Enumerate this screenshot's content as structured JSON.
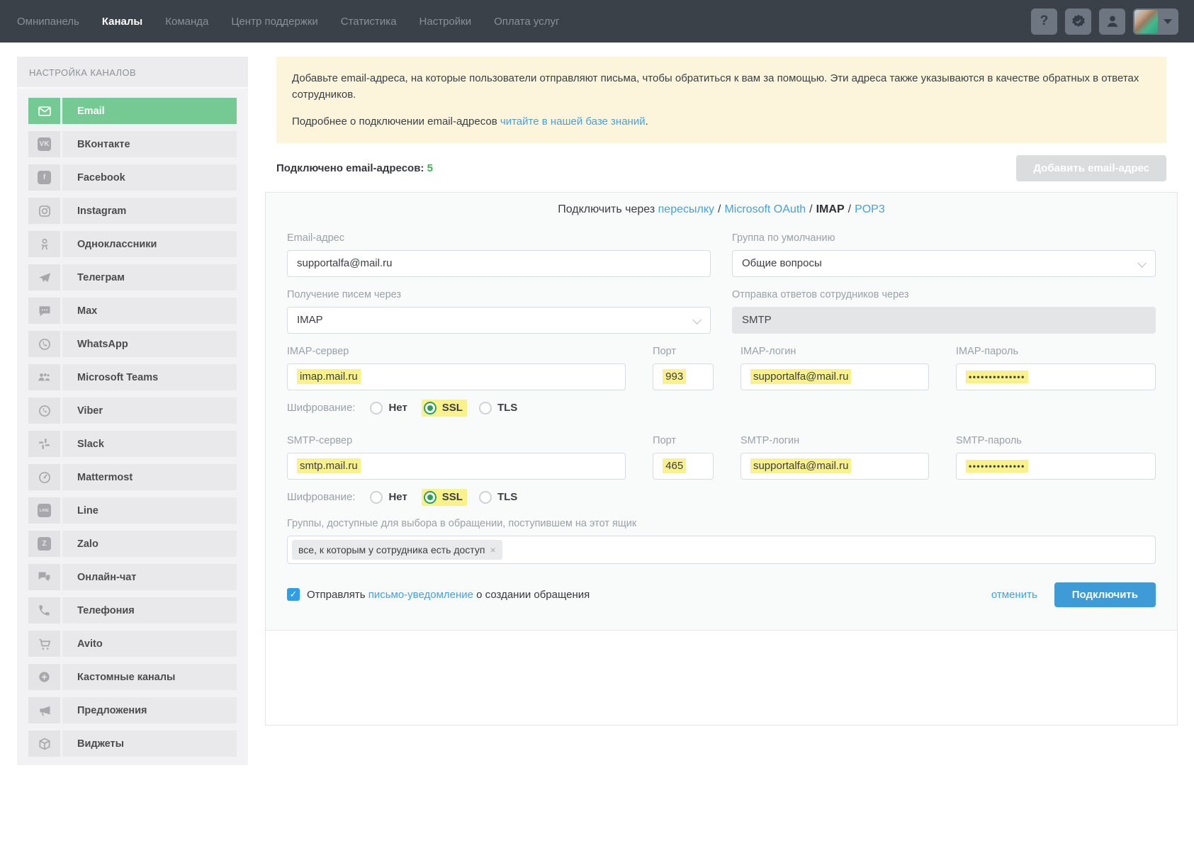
{
  "nav": {
    "items": [
      {
        "id": "omnipanel",
        "label": "Омнипанель",
        "active": false
      },
      {
        "id": "channels",
        "label": "Каналы",
        "active": true
      },
      {
        "id": "team",
        "label": "Команда",
        "active": false
      },
      {
        "id": "support-center",
        "label": "Центр поддержки",
        "active": false
      },
      {
        "id": "statistics",
        "label": "Статистика",
        "active": false
      },
      {
        "id": "settings",
        "label": "Настройки",
        "active": false
      },
      {
        "id": "payment",
        "label": "Оплата услуг",
        "active": false
      }
    ],
    "help_glyph": "?"
  },
  "sidebar": {
    "header": "НАСТРОЙКА КАНАЛОВ",
    "items": [
      {
        "id": "email",
        "label": "Email",
        "icon": "email-icon",
        "active": true
      },
      {
        "id": "vkontakte",
        "label": "ВКонтакте",
        "icon": "vk-icon",
        "active": false
      },
      {
        "id": "facebook",
        "label": "Facebook",
        "icon": "facebook-icon",
        "active": false
      },
      {
        "id": "instagram",
        "label": "Instagram",
        "icon": "instagram-icon",
        "active": false
      },
      {
        "id": "odnoklassniki",
        "label": "Одноклассники",
        "icon": "odnoklassniki-icon",
        "active": false
      },
      {
        "id": "telegram",
        "label": "Телеграм",
        "icon": "telegram-icon",
        "active": false
      },
      {
        "id": "max",
        "label": "Max",
        "icon": "max-icon",
        "active": false
      },
      {
        "id": "whatsapp",
        "label": "WhatsApp",
        "icon": "whatsapp-icon",
        "active": false
      },
      {
        "id": "microsoft-teams",
        "label": "Microsoft Teams",
        "icon": "teams-icon",
        "active": false
      },
      {
        "id": "viber",
        "label": "Viber",
        "icon": "viber-icon",
        "active": false
      },
      {
        "id": "slack",
        "label": "Slack",
        "icon": "slack-icon",
        "active": false
      },
      {
        "id": "mattermost",
        "label": "Mattermost",
        "icon": "mattermost-icon",
        "active": false
      },
      {
        "id": "line",
        "label": "Line",
        "icon": "line-icon",
        "active": false
      },
      {
        "id": "zalo",
        "label": "Zalo",
        "icon": "zalo-icon",
        "active": false
      },
      {
        "id": "online-chat",
        "label": "Онлайн-чат",
        "icon": "chat-icon",
        "active": false
      },
      {
        "id": "telephony",
        "label": "Телефония",
        "icon": "phone-icon",
        "active": false
      },
      {
        "id": "avito",
        "label": "Avito",
        "icon": "cart-icon",
        "active": false
      },
      {
        "id": "custom-channels",
        "label": "Кастомные каналы",
        "icon": "plus-icon",
        "active": false
      },
      {
        "id": "suggestions",
        "label": "Предложения",
        "icon": "megaphone-icon",
        "active": false
      },
      {
        "id": "widgets",
        "label": "Виджеты",
        "icon": "widgets-icon",
        "active": false
      }
    ]
  },
  "main": {
    "info": {
      "p1": "Добавьте email-адреса, на которые пользователи отправляют письма, чтобы обратиться к вам за помощью. Эти адреса также указываются в качестве обратных в ответах сотрудников.",
      "p2_prefix": "Подробнее о подключении email-адресов ",
      "p2_link": "читайте в нашей базе знаний",
      "p2_suffix": "."
    },
    "connected_label": "Подключено email-адресов:",
    "connected_count": "5",
    "add_button": "Добавить email-адрес",
    "methods": {
      "prefix": "Подключить через ",
      "items": [
        {
          "label": "пересылку",
          "active": false
        },
        {
          "label": "Microsoft OAuth",
          "active": false
        },
        {
          "label": "IMAP",
          "active": true
        },
        {
          "label": "POP3",
          "active": false
        }
      ],
      "separator": "/"
    },
    "form": {
      "email": {
        "label": "Email-адрес",
        "value": "supportalfa@mail.ru"
      },
      "group": {
        "label": "Группа по умолчанию",
        "value": "Общие вопросы"
      },
      "receive": {
        "label": "Получение писем через",
        "value": "IMAP"
      },
      "send": {
        "label": "Отправка ответов сотрудников через",
        "value": "SMTP"
      },
      "imap": {
        "server_label": "IMAP-сервер",
        "server": "imap.mail.ru",
        "port_label": "Порт",
        "port": "993",
        "login_label": "IMAP-логин",
        "login": "supportalfa@mail.ru",
        "password_label": "IMAP-пароль",
        "password": "••••••••••••••"
      },
      "smtp": {
        "server_label": "SMTP-сервер",
        "server": "smtp.mail.ru",
        "port_label": "Порт",
        "port": "465",
        "login_label": "SMTP-логин",
        "login": "supportalfa@mail.ru",
        "password_label": "SMTP-пароль",
        "password": "••••••••••••••"
      },
      "encryption": {
        "label": "Шифрование:",
        "options": [
          "Нет",
          "SSL",
          "TLS"
        ],
        "selected": "SSL"
      },
      "groups": {
        "label": "Группы, доступные для выбора в обращении, поступившем на этот ящик",
        "tag": "все, к которым у сотрудника есть доступ",
        "tag_remove": "×"
      },
      "notify": {
        "prefix": "Отправлять ",
        "link": "письмо-уведомление",
        "suffix": " о создании обращения",
        "checked": true,
        "check_glyph": "✓"
      },
      "cancel": "отменить",
      "submit": "Подключить"
    }
  },
  "colors": {
    "nav_bg": "#3a4149",
    "accent_green": "#74ca92",
    "count_green": "#49a85b",
    "highlight_yellow": "#f8f18c",
    "link_blue": "#46a2de",
    "button_blue": "#3e9bd5",
    "info_bg": "#fcf5dc",
    "checkbox_blue": "#2d9fe8"
  }
}
